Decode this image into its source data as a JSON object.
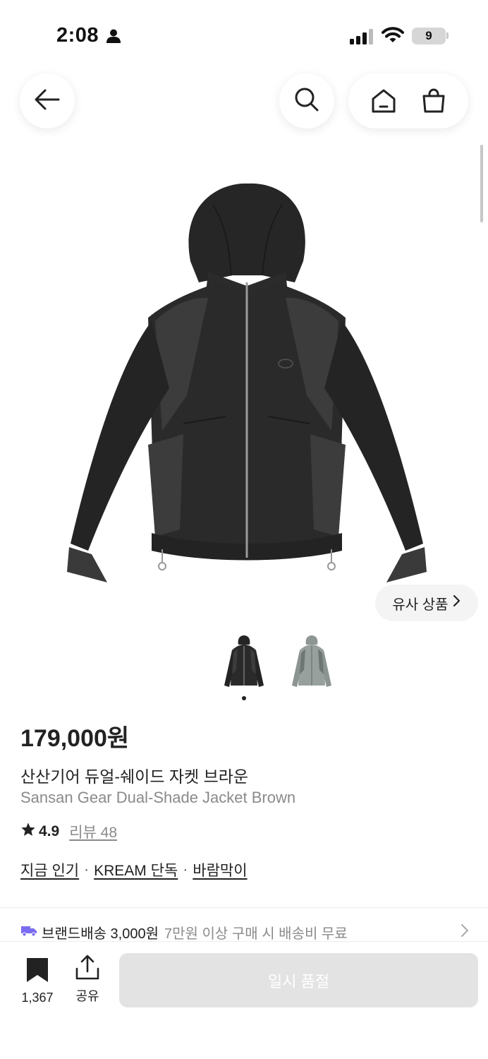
{
  "status_bar": {
    "time": "2:08",
    "battery_level": "9"
  },
  "nav": {
    "back_icon": "arrow-left-icon",
    "search_icon": "search-icon",
    "home_icon": "home-icon",
    "bag_icon": "shopping-bag-icon"
  },
  "gallery": {
    "similar_label": "유사 상품",
    "thumbnails": [
      "black jacket",
      "gray jacket"
    ],
    "active_index": 0
  },
  "product": {
    "price": "179,000원",
    "name_ko": "산산기어 듀얼-쉐이드 자켓 브라운",
    "name_en": "Sansan Gear Dual-Shade Jacket Brown",
    "rating": "4.9",
    "review_label": "리뷰 48",
    "tags": [
      "지금 인기",
      "KREAM 단독",
      "바람막이"
    ]
  },
  "shipping": {
    "label": "브랜드배송 3,000원",
    "note": "7만원 이상 구매 시 배송비 무료"
  },
  "bottom_bar": {
    "save_count": "1,367",
    "share_label": "공유",
    "cta_label": "일시 품절"
  },
  "colors": {
    "accent_truck": "#7a6cf0",
    "cta_disabled": "#e3e3e3"
  }
}
